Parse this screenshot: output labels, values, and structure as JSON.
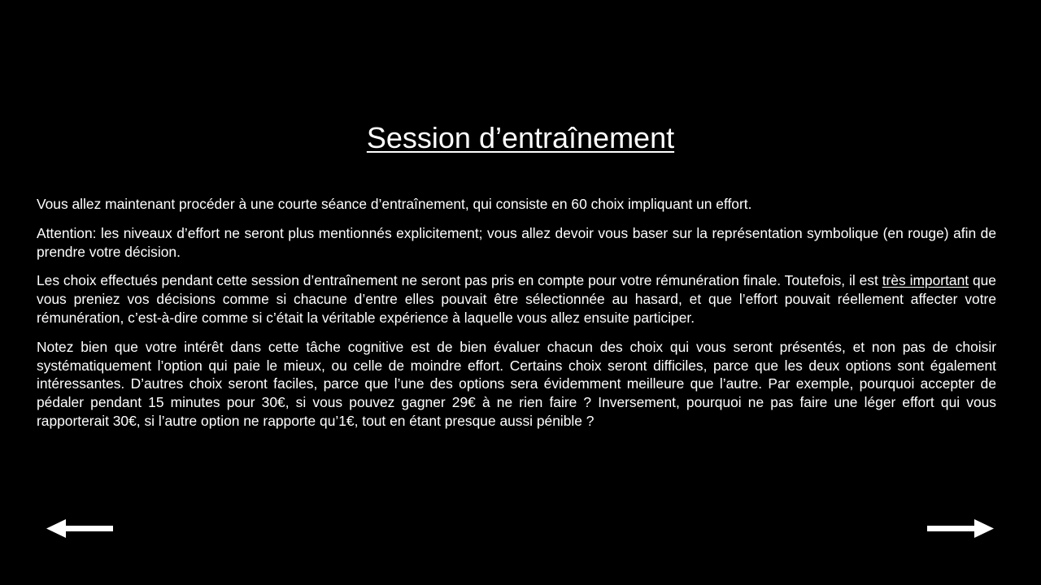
{
  "slide": {
    "title": "Session d’entraînement",
    "paragraphs": {
      "p1": "Vous allez maintenant procéder à une courte séance d’entraînement,  qui consiste en 60 choix impliquant  un effort.",
      "p2": "Attention: les niveaux d’effort ne seront plus mentionnés explicitement;  vous allez devoir vous baser sur la représentation symbolique  (en rouge) afin de prendre  votre décision.",
      "p3_part1": "Les choix effectués pendant  cette session d’entraînement  ne seront pas pris en compte pour votre rémunération  finale. Toutefois, il est ",
      "p3_emphasis": "très important",
      "p3_part2": " que vous preniez vos décisions comme  si chacune d’entre elles pouvait être sélectionnée au hasard, et que l’effort pouvait réellement  affecter votre rémunération,  c’est-à-dire comme  si c’était la véritable expérience à laquelle  vous allez ensuite participer.",
      "p4": "Notez bien que votre intérêt dans cette tâche cognitive est de bien évaluer chacun des choix qui vous seront présentés, et non pas de choisir systématiquement  l’option qui paie le mieux,  ou celle de moindre  effort. Certains choix seront difficiles, parce que les deux options sont également  intéressantes. D’autres choix seront faciles, parce que l’une des options sera évidemment  meilleure que l’autre. Par exemple,  pourquoi accepter de pédaler pendant  15 minutes pour 30€, si vous pouvez gagner 29€ à ne rien faire ? Inversement,  pourquoi ne pas faire une léger effort qui vous rapporterait 30€, si l’autre option ne rapporte qu’1€, tout en étant presque aussi pénible  ?"
    }
  },
  "navigation": {
    "back_icon": "arrow-left-icon",
    "next_icon": "arrow-right-icon"
  },
  "colors": {
    "background": "#000000",
    "text": "#ffffff"
  }
}
